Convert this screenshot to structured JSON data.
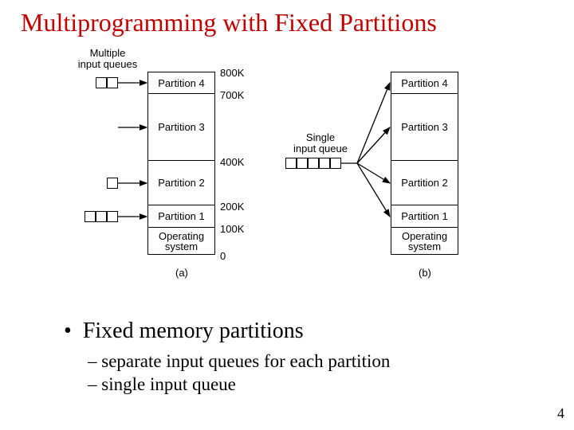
{
  "title": "Multiprogramming with Fixed Partitions",
  "left": {
    "queues_label_line1": "Multiple",
    "queues_label_line2": "input queues",
    "sizes": [
      "800K",
      "700K",
      "400K",
      "200K",
      "100K",
      "0"
    ],
    "blocks": {
      "p4": "Partition 4",
      "p3": "Partition 3",
      "p2": "Partition 2",
      "p1": "Partition 1",
      "os1": "Operating",
      "os2": "system"
    },
    "caption": "(a)"
  },
  "right": {
    "queue_label_line1": "Single",
    "queue_label_line2": "input queue",
    "blocks": {
      "p4": "Partition 4",
      "p3": "Partition 3",
      "p2": "Partition 2",
      "p1": "Partition 1",
      "os1": "Operating",
      "os2": "system"
    },
    "caption": "(b)"
  },
  "bullets": {
    "main": "Fixed memory partitions",
    "sub1": "separate input queues for each partition",
    "sub2": "single input queue"
  },
  "pagenum": "4"
}
